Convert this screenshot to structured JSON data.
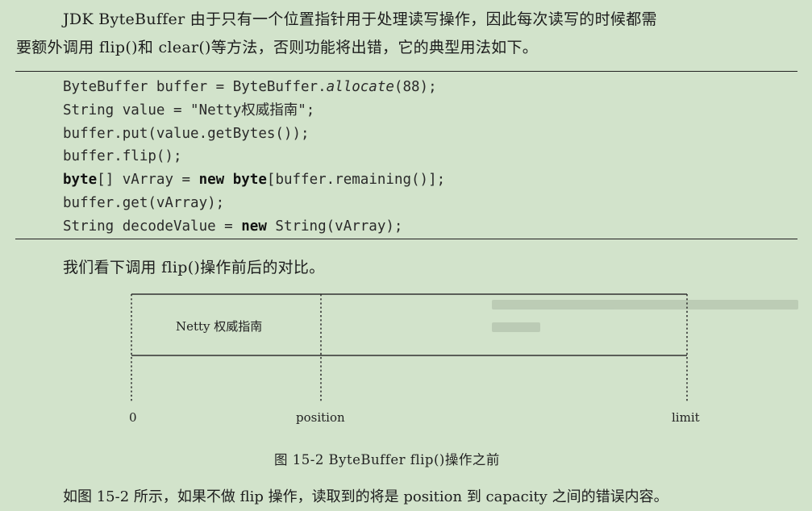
{
  "intro": {
    "line1": "JDK ByteBuffer 由于只有一个位置指针用于处理读写操作，因此每次读写的时候都需",
    "line2": "要额外调用 flip()和 clear()等方法，否则功能将出错，它的典型用法如下。"
  },
  "code": {
    "line1": {
      "a": "ByteBuffer buffer = ByteBuffer.",
      "b": "allocate",
      "c": "(88);"
    },
    "line2": "String value = \"Netty权威指南\";",
    "line3": "buffer.put(value.getBytes());",
    "line4": "buffer.flip();",
    "line5": {
      "kw1": "byte",
      "a": "[] vArray = ",
      "kw2": "new",
      "a2": " ",
      "kw3": "byte",
      "b": "[buffer.remaining()];"
    },
    "line6": "buffer.get(vArray);",
    "line7": {
      "a": "String decodeValue = ",
      "kw": "new",
      "b": " String(vArray);"
    }
  },
  "comparison_text": "我们看下调用 flip()操作前后的对比。",
  "diagram": {
    "cell_text": "Netty 权威指南",
    "label_zero": "0",
    "label_position": "position",
    "label_limit": "limit"
  },
  "caption": "图 15-2    ByteBuffer flip()操作之前",
  "conclusion": "如图 15-2 所示，如果不做 flip 操作，读取到的将是 position 到 capacity 之间的错误内容。"
}
